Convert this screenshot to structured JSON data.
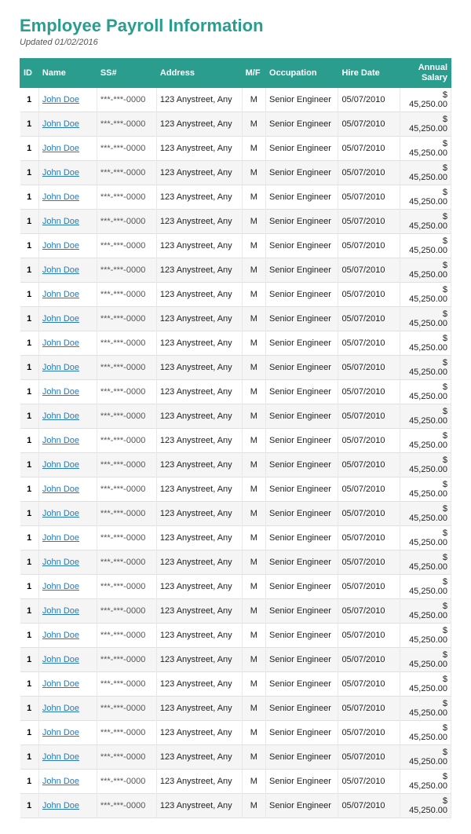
{
  "title": "Employee Payroll Information",
  "updated": "Updated 01/02/2016",
  "table": {
    "headers": [
      "ID",
      "Name",
      "SS#",
      "Address",
      "M/F",
      "Occupation",
      "Hire Date",
      "Annual\nSalary"
    ],
    "row_template": {
      "id": "1",
      "name": "John Doe",
      "ss": "***-***-0000",
      "address": "123 Anystreet, Any",
      "mf": "M",
      "occupation": "Senior Engineer",
      "hire_date": "05/07/2010",
      "salary": "$ 45,250.00"
    },
    "row_count": 30
  },
  "colors": {
    "header_bg": "#2a9d8f",
    "accent": "#2a7ab5",
    "title_color": "#2a9d8f"
  }
}
